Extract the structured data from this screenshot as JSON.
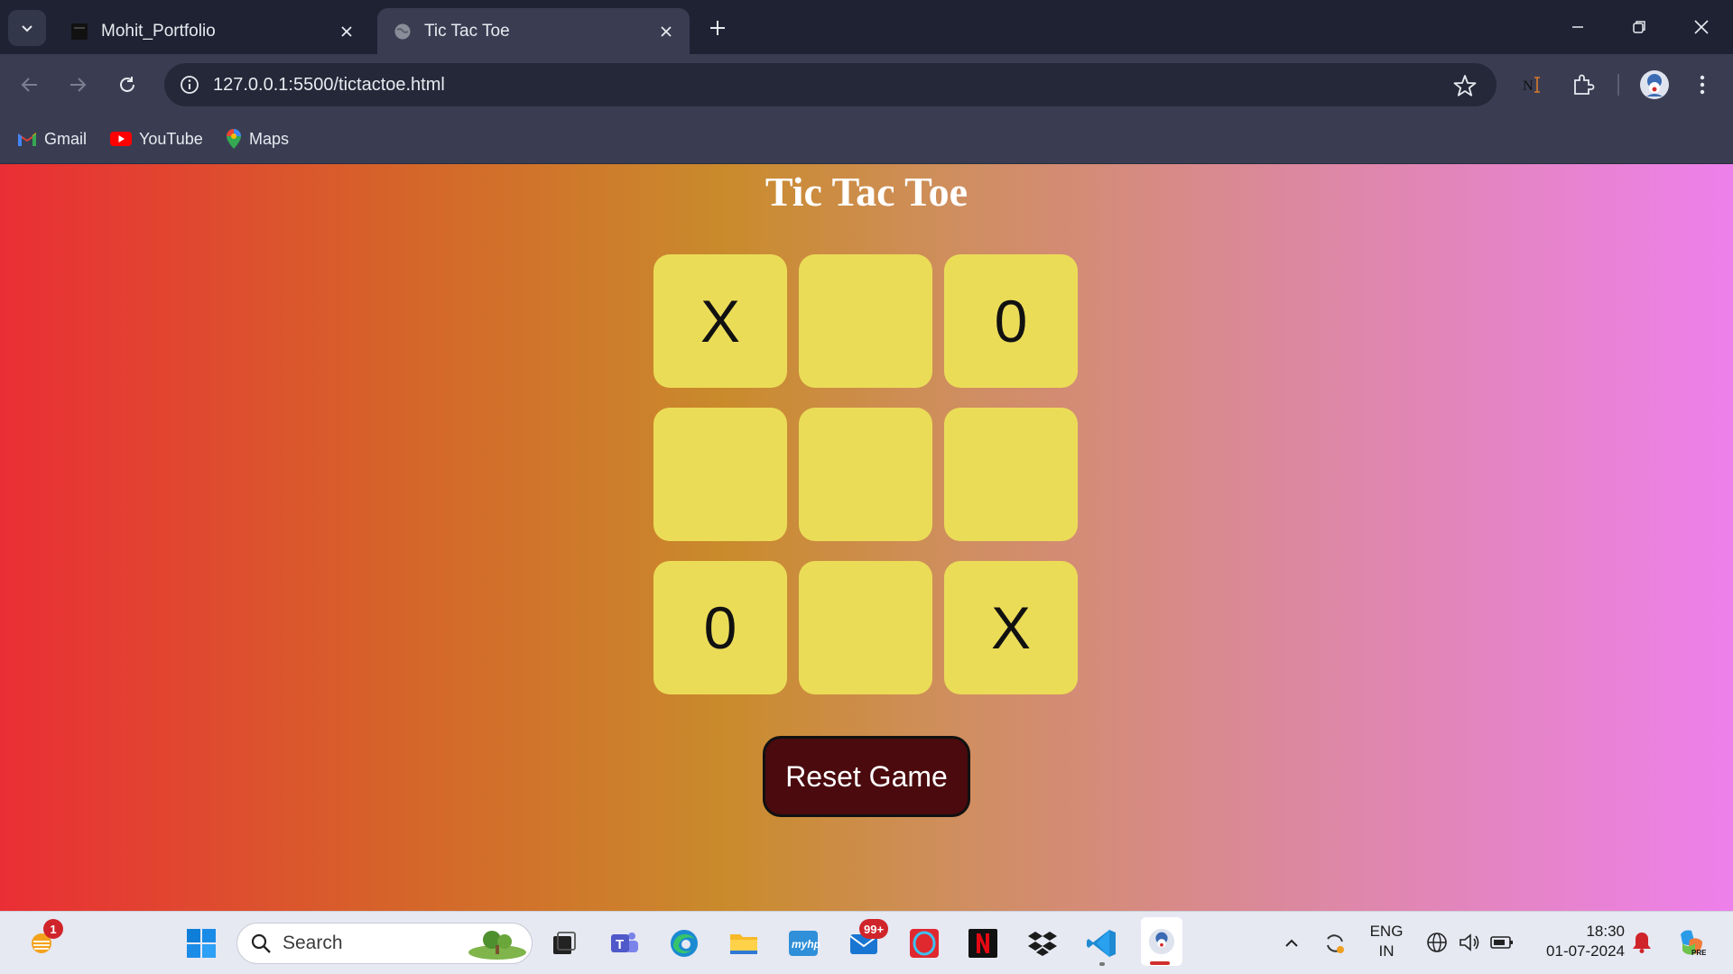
{
  "browser": {
    "tabs": [
      {
        "title": "Mohit_Portfolio",
        "active": false
      },
      {
        "title": "Tic Tac Toe",
        "active": true
      }
    ],
    "address": "127.0.0.1:5500/tictactoe.html",
    "bookmarks": [
      {
        "label": "Gmail",
        "icon": "gmail-icon"
      },
      {
        "label": "YouTube",
        "icon": "youtube-icon"
      },
      {
        "label": "Maps",
        "icon": "maps-icon"
      }
    ]
  },
  "game": {
    "title": "Tic Tac Toe",
    "cells": [
      "X",
      "",
      "0",
      "",
      "",
      "",
      "0",
      "",
      "X"
    ],
    "reset_label": "Reset Game"
  },
  "taskbar": {
    "search_placeholder": "Search",
    "widgets_badge": "1",
    "mail_badge": "99+",
    "lang_line1": "ENG",
    "lang_line2": "IN",
    "time": "18:30",
    "date": "01-07-2024"
  },
  "colors": {
    "gradient_left": "#ea2e35",
    "gradient_right": "#ee80ec",
    "cell": "#ebdc58",
    "reset_button": "#4a0a0e"
  }
}
